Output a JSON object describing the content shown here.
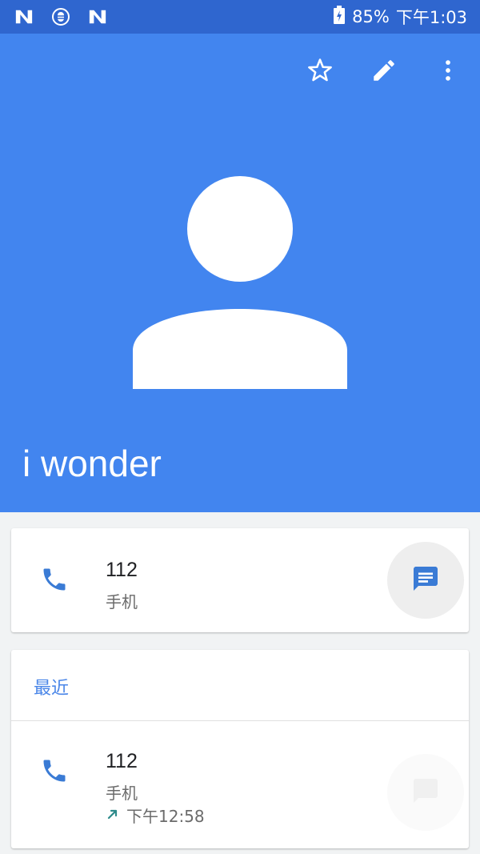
{
  "status_bar": {
    "icons": [
      "n-logo-icon",
      "bug-icon",
      "n-logo-icon"
    ],
    "battery_icon": "battery-charging-icon",
    "battery": "85%",
    "time": "下午1:03"
  },
  "toolbar": {
    "actions": [
      {
        "name": "star-icon",
        "label": "Favorite"
      },
      {
        "name": "edit-icon",
        "label": "Edit"
      },
      {
        "name": "more-vert-icon",
        "label": "More options"
      }
    ]
  },
  "contact": {
    "name": "i wonder",
    "avatar_icon": "person-icon",
    "header_color": "#4285ef"
  },
  "phone_card": {
    "number": "112",
    "type": "手机",
    "call_icon": "phone-icon",
    "message_icon": "message-icon"
  },
  "recent": {
    "title": "最近",
    "entries": [
      {
        "number": "112",
        "type": "手机",
        "direction_icon": "outgoing-call-arrow-icon",
        "time": "下午12:58"
      }
    ]
  },
  "colors": {
    "accent": "#4285ef",
    "status_bar": "#2f66cf",
    "call_icon": "#3a7bd5",
    "outgoing_arrow": "#2e8b8b"
  }
}
